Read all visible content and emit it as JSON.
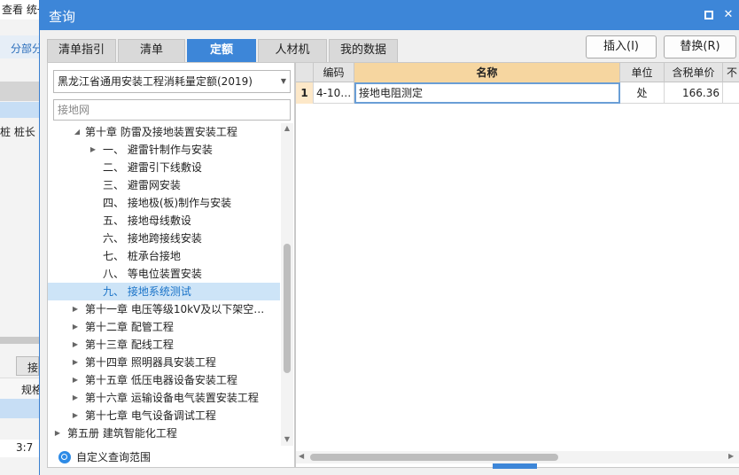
{
  "background": {
    "menu_text": "查看  统一",
    "bar_text": "分部分",
    "row_text": "桩  桩长",
    "tab_text": "接",
    "row2_text": "规格",
    "row3_text": "3:7"
  },
  "dialog": {
    "title": "查询",
    "tabs": [
      "清单指引",
      "清单",
      "定额",
      "人材机",
      "我的数据"
    ],
    "active_tab": "定额",
    "insert_label": "插入(I)",
    "replace_label": "替换(R)"
  },
  "left": {
    "quota_select": "黑龙江省通用安装工程消耗量定额(2019)",
    "search_value": "接地网",
    "tree": [
      {
        "label": "第十章  防雷及接地装置安装工程",
        "expanded": true
      },
      {
        "label": "一、  避雷针制作与安装",
        "expanded": false
      },
      {
        "label": "二、  避雷引下线敷设"
      },
      {
        "label": "三、  避雷网安装"
      },
      {
        "label": "四、  接地极(板)制作与安装"
      },
      {
        "label": "五、  接地母线敷设"
      },
      {
        "label": "六、  接地跨接线安装"
      },
      {
        "label": "七、  桩承台接地"
      },
      {
        "label": "八、  等电位装置安装"
      },
      {
        "label": "九、  接地系统测试",
        "selected": true
      },
      {
        "label": "第十一章  电压等级10kV及以下架空…",
        "expanded": false
      },
      {
        "label": "第十二章  配管工程",
        "expanded": false
      },
      {
        "label": "第十三章  配线工程",
        "expanded": false
      },
      {
        "label": "第十四章  照明器具安装工程",
        "expanded": false
      },
      {
        "label": "第十五章  低压电器设备安装工程",
        "expanded": false
      },
      {
        "label": "第十六章  运输设备电气装置安装工程",
        "expanded": false
      },
      {
        "label": "第十七章  电气设备调试工程",
        "expanded": false
      },
      {
        "label": "第五册  建筑智能化工程",
        "expanded": false
      }
    ],
    "custom_range_label": "自定义查询范围"
  },
  "grid": {
    "headers": [
      "编码",
      "名称",
      "单位",
      "含税单价",
      "不"
    ],
    "rows": [
      {
        "num": "1",
        "code": "4-10…",
        "name": "接地电阻测定",
        "unit": "处",
        "price": "166.36"
      }
    ]
  }
}
